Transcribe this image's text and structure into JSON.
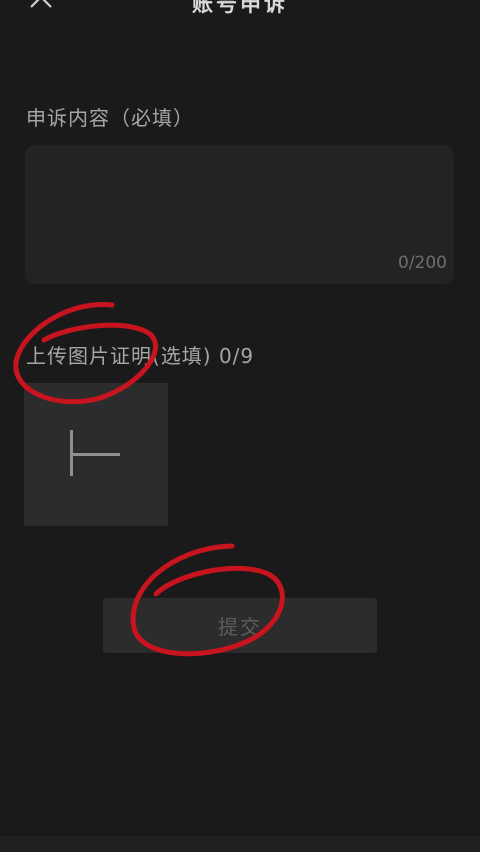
{
  "header": {
    "title": "账号申诉",
    "close_icon": "close-icon"
  },
  "content_section": {
    "label": "申诉内容（必填）",
    "input_value": "",
    "counter": "0/200"
  },
  "upload_section": {
    "label": "上传图片证明(选填) 0/9",
    "add_icon": "plus-icon"
  },
  "submit": {
    "label": "提交"
  },
  "colors": {
    "background": "#1a1a1a",
    "surface": "#232323",
    "tile": "#2c2c2c",
    "annotation_red": "#c8141e"
  }
}
